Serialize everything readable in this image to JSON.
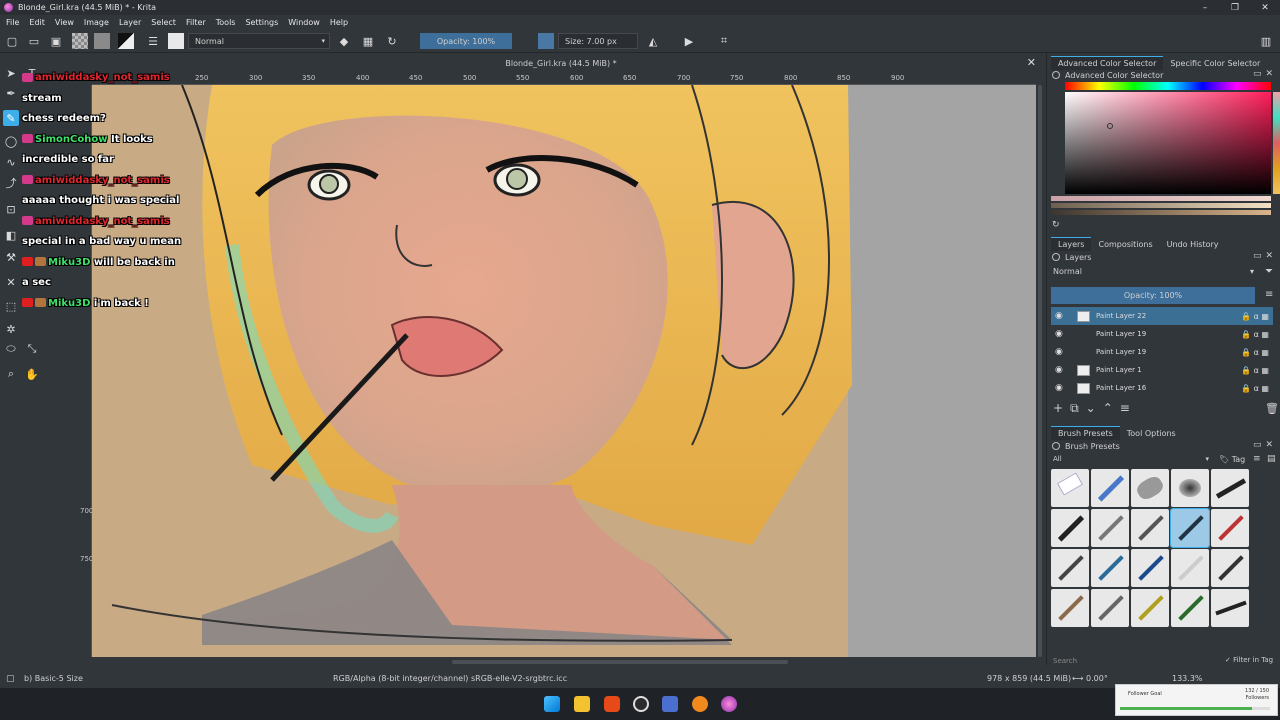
{
  "window": {
    "title": "Blonde_Girl.kra (44.5 MiB) * - Krita",
    "minimize": "–",
    "maximize": "❐",
    "close": "✕"
  },
  "menu": [
    "File",
    "Edit",
    "View",
    "Image",
    "Layer",
    "Select",
    "Filter",
    "Tools",
    "Settings",
    "Window",
    "Help"
  ],
  "toolbar": {
    "blend_mode": "Normal",
    "opacity_label": "Opacity: 100%",
    "size_label": "Size: 7.00 px"
  },
  "document": {
    "tab_title": "Blonde_Girl.kra (44.5 MiB) *",
    "close": "✕"
  },
  "ruler": {
    "h_ticks": [
      "250",
      "300",
      "350",
      "400",
      "450",
      "500",
      "550",
      "600",
      "650",
      "700",
      "750",
      "800",
      "850",
      "900"
    ],
    "v_ticks": [
      "700",
      "750"
    ]
  },
  "chat": [
    {
      "user": "amiwiddasky_not_samis",
      "text": "stream",
      "user_color": "#e0262f"
    },
    {
      "user": "",
      "text": "chess redeem?",
      "user_color": "#e0262f"
    },
    {
      "user": "SimonCohow",
      "text": "It looks",
      "user_color": "#3ee06a"
    },
    {
      "user": "",
      "text": "incredible so far",
      "user_color": "#3ee06a"
    },
    {
      "user": "amiwiddasky_not_samis",
      "text": "",
      "user_color": "#e0262f"
    },
    {
      "user": "",
      "text": "aaaaa thought i was special",
      "user_color": "#e0262f"
    },
    {
      "user": "amiwiddasky_not_samis",
      "text": "",
      "user_color": "#e0262f"
    },
    {
      "user": "",
      "text": "special in a bad way u mean",
      "user_color": "#e0262f"
    },
    {
      "user": "Miku3D",
      "text": "will be back in",
      "user_color": "#3ee06a"
    },
    {
      "user": "",
      "text": "a sec",
      "user_color": "#3ee06a"
    },
    {
      "user": "Miku3D",
      "text": "i'm back !",
      "user_color": "#3ee06a"
    }
  ],
  "right_panel": {
    "color_tabs": [
      "Advanced Color Selector",
      "Specific Color Selector"
    ],
    "color_title": "Advanced Color Selector",
    "layer_tabs": [
      "Layers",
      "Compositions",
      "Undo History"
    ],
    "layers_title": "Layers",
    "layer_blend": "Normal",
    "layer_opacity": "Opacity:  100%",
    "layers": [
      {
        "name": "Paint Layer 22",
        "selected": true
      },
      {
        "name": "Paint Layer 19",
        "selected": false
      },
      {
        "name": "Paint Layer 19",
        "selected": false
      },
      {
        "name": "Paint Layer 1",
        "selected": false
      },
      {
        "name": "Paint Layer 16",
        "selected": false
      }
    ],
    "brush_tabs": [
      "Brush Presets",
      "Tool Options"
    ],
    "brush_title": "Brush Presets",
    "brush_filter": "All",
    "brush_tag": "Tag",
    "search_placeholder": "Search",
    "filter_in_tag": "Filter in Tag"
  },
  "status": {
    "brush": "b) Basic-5 Size",
    "colorspace": "RGB/Alpha (8-bit integer/channel)  sRGB-elle-V2-srgbtrc.icc",
    "dimensions": "978 x 859 (44.5 MiB)",
    "rotation": "0.00°",
    "zoom": "133.3%"
  },
  "notification": {
    "title": "Follower Goal",
    "value": "132 / 150",
    "sub": "Followers"
  }
}
